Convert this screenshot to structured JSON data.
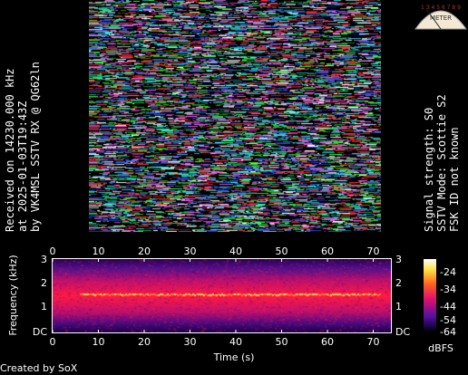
{
  "sstv_image": {
    "description_colors": [
      "#ff3030",
      "#30ff30",
      "#3060ff",
      "#ff60ff",
      "#ffffff",
      "#30ffff"
    ]
  },
  "left_caption": {
    "line1": "Received on  14230.000 kHz",
    "line2": "at 2025-01-03T19:43Z",
    "line3": "by VK4MSL SSTV RX @ QG62ln"
  },
  "right_caption": {
    "line1": "Signal strength: S0",
    "line2": "SSTV Mode: Scottie S2",
    "line3": "FSK ID not known"
  },
  "meter": {
    "scale_text": "1 3 4 5 6 7 8 9",
    "label": "METER"
  },
  "spectrogram": {
    "ylabel": "Frequency (kHz)",
    "xlabel": "Time (s)",
    "x_ticks": [
      "0",
      "10",
      "20",
      "30",
      "40",
      "50",
      "60",
      "70"
    ],
    "y_ticks_left": [
      "3",
      "2",
      "1",
      "DC"
    ],
    "y_ticks_right": [
      "3",
      "2",
      "1",
      "DC"
    ],
    "colorbar_ticks": [
      "-24",
      "-34",
      "-44",
      "-54",
      "-64"
    ],
    "colorbar_unit": "dBFS",
    "colors": {
      "low": "#200060",
      "mid": "#e0106a",
      "high": "#ff2040",
      "peak": "#ffd040"
    }
  },
  "credit": "Created by SoX"
}
